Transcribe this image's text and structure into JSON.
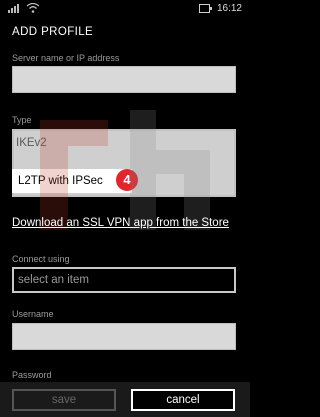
{
  "status_bar": {
    "time": "16:12"
  },
  "page": {
    "title": "ADD PROFILE"
  },
  "server": {
    "label": "Server name or IP address"
  },
  "type": {
    "label": "Type",
    "options": [
      "IKEv2",
      "L2TP with IPSec"
    ],
    "selected_index": 1
  },
  "badge": {
    "number": "4",
    "color": "#e0262d"
  },
  "store_link": "Download an SSL VPN app from the Store",
  "connect": {
    "label": "Connect using",
    "placeholder": "select an item"
  },
  "username": {
    "label": "Username"
  },
  "password": {
    "label": "Password"
  },
  "app_bar": {
    "save": "save",
    "cancel": "cancel"
  }
}
